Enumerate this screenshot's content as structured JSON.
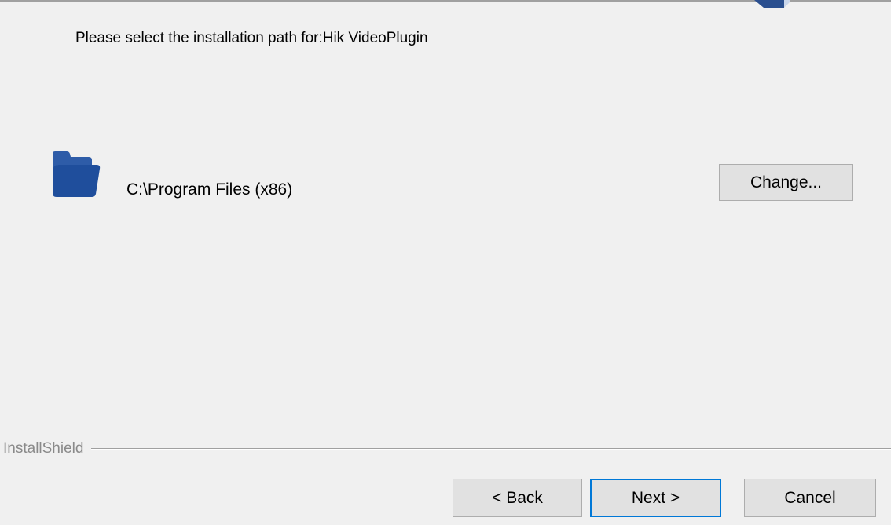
{
  "dialog": {
    "instruction": "Please select the installation path for:Hik VideoPlugin",
    "install_path": "C:\\Program Files (x86)",
    "change_label": "Change...",
    "brand_label": "InstallShield"
  },
  "footer": {
    "back_label": "< Back",
    "next_label": "Next >",
    "cancel_label": "Cancel"
  },
  "icons": {
    "folder": "folder-icon",
    "header_logo": "installer-logo-icon"
  },
  "colors": {
    "background": "#f0f0f0",
    "folder": "#1f4e9c",
    "default_button_border": "#0078d7",
    "button_face": "#e1e1e1"
  }
}
